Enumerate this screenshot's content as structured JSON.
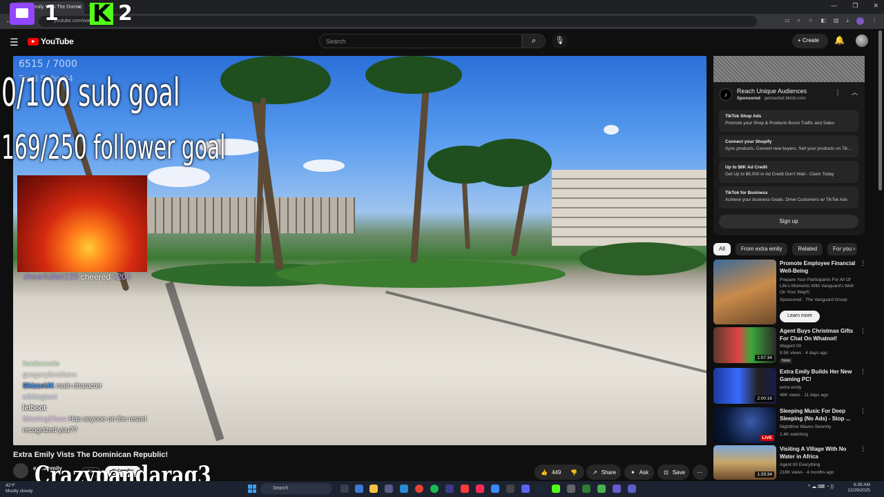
{
  "browser": {
    "tab_title": "Extra Emily Vists The Domini",
    "url": "youtube.com/watch?v=...",
    "window_controls": [
      "—",
      "❐",
      "✕"
    ]
  },
  "overlay": {
    "num1": "1",
    "num2": "2",
    "stream_count": "6515 / 7000",
    "stream_subs": "Total Subs 84",
    "sub_goal": "0/100 sub goal",
    "follower_goal": "169/250 follower goal",
    "cheer_user": "cheerfulfan120",
    "cheer_text": "cheered",
    "cheer_amount": "x200",
    "chat": [
      {
        "user": "foxdevsolo",
        "text": "",
        "color": "#7dd37d",
        "blur": true
      },
      {
        "user": "gregorybrothers",
        "text": "",
        "color": "#b0b0b0",
        "blur": true
      },
      {
        "user": "SkizzoUK",
        "text": "main character",
        "color": "#4d9bff",
        "blur": false
      },
      {
        "user": "whitegiant",
        "text": "",
        "color": "#7da7ff",
        "blur": true
      },
      {
        "user": "letboot",
        "text": "",
        "color": "#ffffff",
        "blur": false
      },
      {
        "user": "MissingClass",
        "text": "Has anyone on the resort",
        "color": "#c77dff",
        "blur": true
      },
      {
        "user": "",
        "text": "recognized you??",
        "color": "#ffffff",
        "blur": false
      }
    ],
    "streamer_name": "Crazypandarag3"
  },
  "youtube": {
    "logo_text": "YouTube",
    "search_placeholder": "Search",
    "create_label": "Create",
    "video_title": "Extra Emily Vists The Dominican Republic!",
    "channel_name": "extra emily",
    "channel_subs": "5K subscribers",
    "join_label": "Join",
    "subscribe_label": "Subscribe",
    "likes": "449",
    "share_label": "Share",
    "ask_label": "Ask",
    "save_label": "Save"
  },
  "ad": {
    "title": "Reach Unique Audiences",
    "sponsored": "Sponsored",
    "domain": "getstarted.tiktok.com",
    "items": [
      {
        "title": "TikTok Shop Ads",
        "desc": "Promote your Shop & Products Boost Traffic and Sales"
      },
      {
        "title": "Connect your Shopify",
        "desc": "Sync products. Convert new buyers. Sell your products on Tik..."
      },
      {
        "title": "Up to $6K Ad Credit",
        "desc": "Get Up to $6,000 in Ad Credit Don't Wait - Claim Today"
      },
      {
        "title": "TikTok for Business",
        "desc": "Achieve your business Goals. Drive Customers w/ TikTok Ads"
      }
    ],
    "signup": "Sign up"
  },
  "chips": [
    "All",
    "From extra emily",
    "Related",
    "For you"
  ],
  "recommendations": [
    {
      "title": "Promote Employee Financial Well-Being",
      "meta1": "Prepare Your Participants For All Of Life's Moments With Vanguard's Well On Your Way®.",
      "meta2": "Sponsored · The Vanguard Group",
      "cta": "Learn more"
    },
    {
      "title": "Agent Buys Christmas Gifts For Chat On Whatnot!",
      "meta1": "Wagent 00",
      "meta2": "9.5K views · 4 days ago",
      "duration": "1:07:34",
      "badge": "New"
    },
    {
      "title": "Extra Emily Builds Her New Gaming PC!",
      "meta1": "extra emily",
      "meta2": "48K views · 11 days ago",
      "duration": "2:00:16"
    },
    {
      "title": "Sleeping Music For Deep Sleeping (No Ads) - Stop ...",
      "meta1": "Nighttime Waves Serenity",
      "meta2": "1.4K watching",
      "live": "LIVE"
    },
    {
      "title": "Visiting A Village With No Water in Africa",
      "meta1": "Agent 00 Everything",
      "meta2": "216K views · 4 months ago",
      "duration": "1:29:34"
    }
  ],
  "taskbar": {
    "temp": "42°F",
    "weather": "Mostly cloudy",
    "search": "Search",
    "time": "6:39 AM",
    "date": "12/29/2025"
  }
}
